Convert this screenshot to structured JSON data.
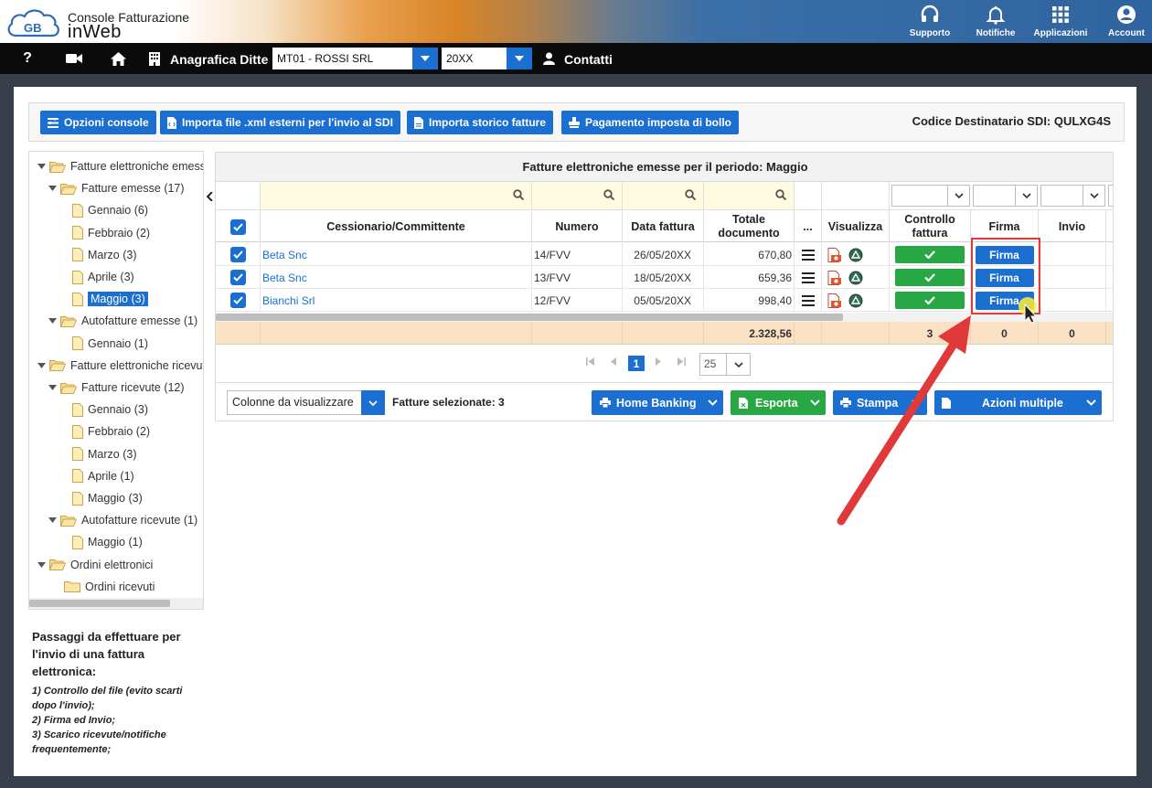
{
  "header": {
    "brand_line1": "Console Fatturazione",
    "brand_line2": "inWeb",
    "logo_text": "GB",
    "icons": [
      {
        "label": "Supporto",
        "icon": "headset-icon"
      },
      {
        "label": "Notifiche",
        "icon": "bell-icon"
      },
      {
        "label": "Applicazioni",
        "icon": "apps-grid-icon"
      },
      {
        "label": "Account",
        "icon": "user-circle-icon"
      }
    ]
  },
  "nav": {
    "help": "?",
    "anagrafica_label": "Anagrafica Ditte",
    "company_value": "MT01 - ROSSI SRL",
    "year_value": "20XX",
    "contatti_label": "Contatti"
  },
  "toolbar": {
    "opzioni": "Opzioni console",
    "importa_xml": "Importa file .xml esterni per l'invio al SDI",
    "importa_storico": "Importa storico fatture",
    "pagamento": "Pagamento imposta di bollo",
    "sdi": "Codice Destinatario SDI: QULXG4S"
  },
  "tree": [
    {
      "label": "Fatture elettroniche emesse",
      "level": 0,
      "type": "open",
      "caret": true
    },
    {
      "label": "Fatture emesse (17)",
      "level": 1,
      "type": "open",
      "caret": true
    },
    {
      "label": "Gennaio (6)",
      "level": 2,
      "type": "file"
    },
    {
      "label": "Febbraio (2)",
      "level": 2,
      "type": "file"
    },
    {
      "label": "Marzo (3)",
      "level": 2,
      "type": "file"
    },
    {
      "label": "Aprile (3)",
      "level": 2,
      "type": "file"
    },
    {
      "label": "Maggio (3)",
      "level": 2,
      "type": "file",
      "active": true
    },
    {
      "label": "Autofatture emesse (1)",
      "level": 1,
      "type": "open",
      "caret": true
    },
    {
      "label": "Gennaio (1)",
      "level": 2,
      "type": "file"
    },
    {
      "label": "Fatture elettroniche ricevute",
      "level": 0,
      "type": "open",
      "caret": true
    },
    {
      "label": "Fatture ricevute (12)",
      "level": 1,
      "type": "open",
      "caret": true
    },
    {
      "label": "Gennaio (3)",
      "level": 2,
      "type": "file"
    },
    {
      "label": "Febbraio (2)",
      "level": 2,
      "type": "file"
    },
    {
      "label": "Marzo (3)",
      "level": 2,
      "type": "file"
    },
    {
      "label": "Aprile (1)",
      "level": 2,
      "type": "file"
    },
    {
      "label": "Maggio (3)",
      "level": 2,
      "type": "file"
    },
    {
      "label": "Autofatture ricevute (1)",
      "level": 1,
      "type": "open",
      "caret": true
    },
    {
      "label": "Maggio (1)",
      "level": 2,
      "type": "file"
    },
    {
      "label": "Ordini elettronici",
      "level": 0,
      "type": "open",
      "caret": true
    },
    {
      "label": "Ordini ricevuti",
      "level": 1,
      "type": "closed"
    }
  ],
  "steps": {
    "title": "Passaggi da effettuare per l'invio di una fattura elettronica:",
    "items": [
      "1) Controllo del file (evito scarti dopo l'invio);",
      "2) Firma ed Invio;",
      "3) Scarico ricevute/notifiche frequentemente;"
    ]
  },
  "grid": {
    "title": "Fatture elettroniche emesse per il periodo: Maggio",
    "headers": {
      "cessionario": "Cessionario/Committente",
      "numero": "Numero",
      "data": "Data fattura",
      "totale": "Totale documento",
      "more": "...",
      "visualizza": "Visualizza",
      "controllo": "Controllo fattura",
      "firma": "Firma",
      "invio": "Invio"
    },
    "rows": [
      {
        "cessionario": "Beta Snc",
        "numero": "14/FVV",
        "data": "26/05/20XX",
        "totale": "670,80",
        "firma": "Firma"
      },
      {
        "cessionario": "Beta Snc",
        "numero": "13/FVV",
        "data": "18/05/20XX",
        "totale": "659,36",
        "firma": "Firma"
      },
      {
        "cessionario": "Bianchi Srl",
        "numero": "12/FVV",
        "data": "05/05/20XX",
        "totale": "998,40",
        "firma": "Firma"
      }
    ],
    "totals": {
      "totale": "2.328,56",
      "controllo": "3",
      "firma": "0",
      "invio": "0"
    },
    "pager": {
      "current": "1",
      "page_size": "25"
    }
  },
  "bottom": {
    "colonne": "Colonne da visualizzare",
    "selected": "Fatture selezionate: 3",
    "home_banking": "Home Banking",
    "esporta": "Esporta",
    "stampa": "Stampa",
    "azioni": "Azioni multiple"
  },
  "colors": {
    "primary": "#1a6fd0",
    "success": "#28a745",
    "totals_bg": "#fbe1c4",
    "highlight": "#e0393a"
  }
}
